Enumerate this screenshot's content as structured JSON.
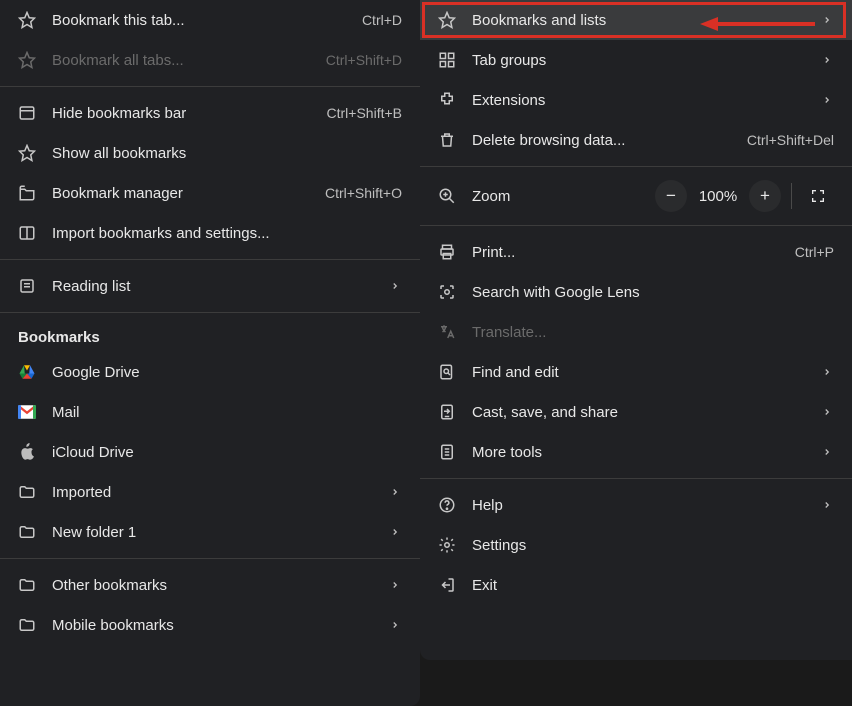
{
  "left": {
    "bookmark_tab": {
      "label": "Bookmark this tab...",
      "shortcut": "Ctrl+D"
    },
    "bookmark_all": {
      "label": "Bookmark all tabs...",
      "shortcut": "Ctrl+Shift+D"
    },
    "hide_bar": {
      "label": "Hide bookmarks bar",
      "shortcut": "Ctrl+Shift+B"
    },
    "show_all": {
      "label": "Show all bookmarks"
    },
    "manager": {
      "label": "Bookmark manager",
      "shortcut": "Ctrl+Shift+O"
    },
    "import": {
      "label": "Import bookmarks and settings..."
    },
    "reading_list": {
      "label": "Reading list"
    },
    "section_title": "Bookmarks",
    "items": {
      "gdrive": {
        "label": "Google Drive"
      },
      "mail": {
        "label": "Mail"
      },
      "icloud": {
        "label": "iCloud Drive"
      },
      "imported": {
        "label": "Imported"
      },
      "newfolder": {
        "label": "New folder 1"
      }
    },
    "other": {
      "label": "Other bookmarks"
    },
    "mobile": {
      "label": "Mobile bookmarks"
    }
  },
  "right": {
    "bookmarks_lists": {
      "label": "Bookmarks and lists"
    },
    "tab_groups": {
      "label": "Tab groups"
    },
    "extensions": {
      "label": "Extensions"
    },
    "delete_data": {
      "label": "Delete browsing data...",
      "shortcut": "Ctrl+Shift+Del"
    },
    "zoom": {
      "label": "Zoom",
      "value": "100%"
    },
    "print": {
      "label": "Print...",
      "shortcut": "Ctrl+P"
    },
    "lens": {
      "label": "Search with Google Lens"
    },
    "translate": {
      "label": "Translate..."
    },
    "find_edit": {
      "label": "Find and edit"
    },
    "cast": {
      "label": "Cast, save, and share"
    },
    "more_tools": {
      "label": "More tools"
    },
    "help": {
      "label": "Help"
    },
    "settings": {
      "label": "Settings"
    },
    "exit": {
      "label": "Exit"
    }
  }
}
